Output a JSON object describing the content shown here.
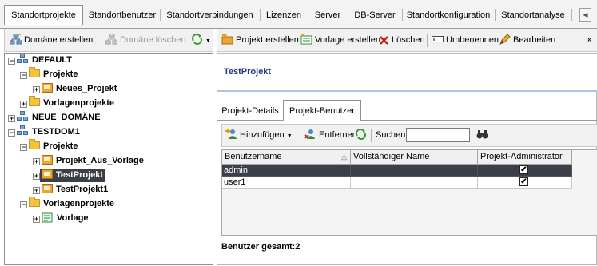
{
  "top_tabs": [
    "Standortprojekte",
    "Standortbenutzer",
    "Standortverbindungen",
    "Lizenzen",
    "Server",
    "DB-Server",
    "Standortkonfiguration",
    "Standortanalyse"
  ],
  "left_toolbar": {
    "create_domain": "Domäne erstellen",
    "delete_domain": "Domäne löschen"
  },
  "right_toolbar": {
    "create_project": "Projekt erstellen",
    "create_template": "Vorlage erstellen",
    "delete": "Löschen",
    "rename": "Umbenennen",
    "edit": "Bearbeiten",
    "overflow": "»"
  },
  "tree": [
    {
      "label": "DEFAULT",
      "icon": "domain-icon",
      "expander": "−"
    },
    {
      "label": "Projekte",
      "icon": "folder-icon",
      "expander": "−"
    },
    {
      "label": "Neues_Projekt",
      "icon": "project-icon",
      "expander": "+"
    },
    {
      "label": "Vorlagenprojekte",
      "icon": "folder-icon",
      "expander": "+"
    },
    {
      "label": "NEUE_DOMÄNE",
      "icon": "domain-icon",
      "expander": "+"
    },
    {
      "label": "TESTDOM1",
      "icon": "domain-icon",
      "expander": "−"
    },
    {
      "label": "Projekte",
      "icon": "folder-icon",
      "expander": "−"
    },
    {
      "label": "Projekt_Aus_Vorlage",
      "icon": "project-icon",
      "expander": "+"
    },
    {
      "label": "TestProjekt",
      "icon": "project-icon",
      "expander": "+",
      "selected": true
    },
    {
      "label": "TestProjekt1",
      "icon": "project-icon",
      "expander": "+"
    },
    {
      "label": "Vorlagenprojekte",
      "icon": "folder-icon",
      "expander": "−"
    },
    {
      "label": "Vorlage",
      "icon": "template-icon",
      "expander": "+"
    }
  ],
  "detail": {
    "title": "TestProjekt",
    "tabs": [
      "Projekt-Details",
      "Projekt-Benutzer"
    ],
    "active_tab": "Projekt-Benutzer"
  },
  "users_toolbar": {
    "add": "Hinzufügen",
    "remove": "Entfernen",
    "search_label": "Suchen",
    "search_value": ""
  },
  "grid": {
    "columns": [
      "Benutzername",
      "Vollständiger Name",
      "Projekt-Administrator"
    ],
    "rows": [
      {
        "username": "admin",
        "fullname": "",
        "admin": true,
        "selected": true
      },
      {
        "username": "user1",
        "fullname": "",
        "admin": true,
        "selected": false
      }
    ]
  },
  "footer": {
    "label": "Benutzer gesamt:",
    "count": "2"
  },
  "colors": {
    "selection": "#3a3f48",
    "header_title": "#1f3c88",
    "accent_line": "#b0c4de"
  }
}
